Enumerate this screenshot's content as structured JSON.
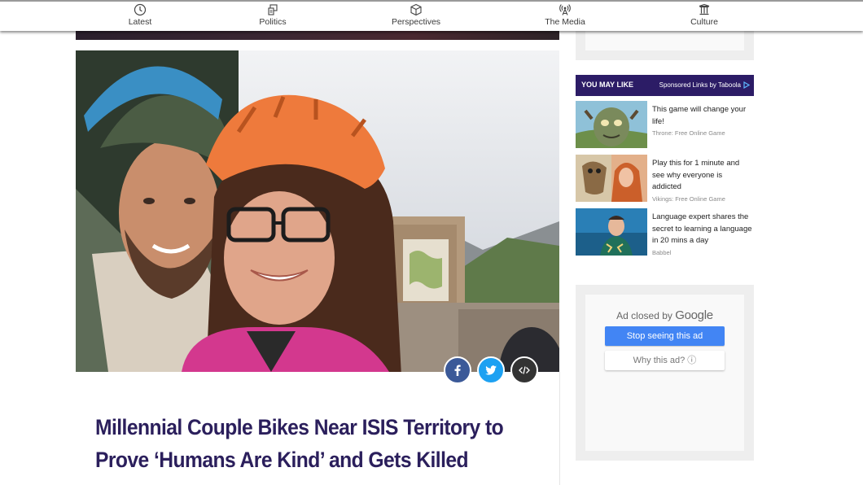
{
  "nav": {
    "items": [
      {
        "label": "Latest",
        "icon": "clock-icon"
      },
      {
        "label": "Politics",
        "icon": "politics-icon"
      },
      {
        "label": "Perspectives",
        "icon": "box-icon"
      },
      {
        "label": "The Media",
        "icon": "broadcast-icon"
      },
      {
        "label": "Culture",
        "icon": "columns-icon"
      }
    ]
  },
  "article": {
    "headline": "Millennial Couple Bikes Near ISIS Territory to Prove ‘Humans Are Kind’ and Gets Killed",
    "headline_color": "#2b1f5c",
    "share_buttons": [
      {
        "icon": "facebook-icon",
        "color": "#3b5998"
      },
      {
        "icon": "twitter-icon",
        "color": "#1da1f2"
      },
      {
        "icon": "embed-code-icon",
        "color": "#333333"
      }
    ]
  },
  "sidebar": {
    "you_may_like": "YOU MAY LIKE",
    "sponsored": "Sponsored Links by Taboola",
    "bar_color": "#2c1c66",
    "ads": [
      {
        "title": "This game will change your life!",
        "source": "Throne: Free Online Game"
      },
      {
        "title": "Play this for 1 minute and see why everyone is addicted",
        "source": "Vikings: Free Online Game"
      },
      {
        "title": "Language expert shares the secret to learning a language in 20 mins a day",
        "source": "Babbel"
      }
    ],
    "ad_closed": {
      "prefix": "Ad closed by",
      "brand": "Google",
      "stop_button": "Stop seeing this ad",
      "why_button": "Why this ad? ⓘ",
      "button_color": "#4285f4"
    }
  }
}
